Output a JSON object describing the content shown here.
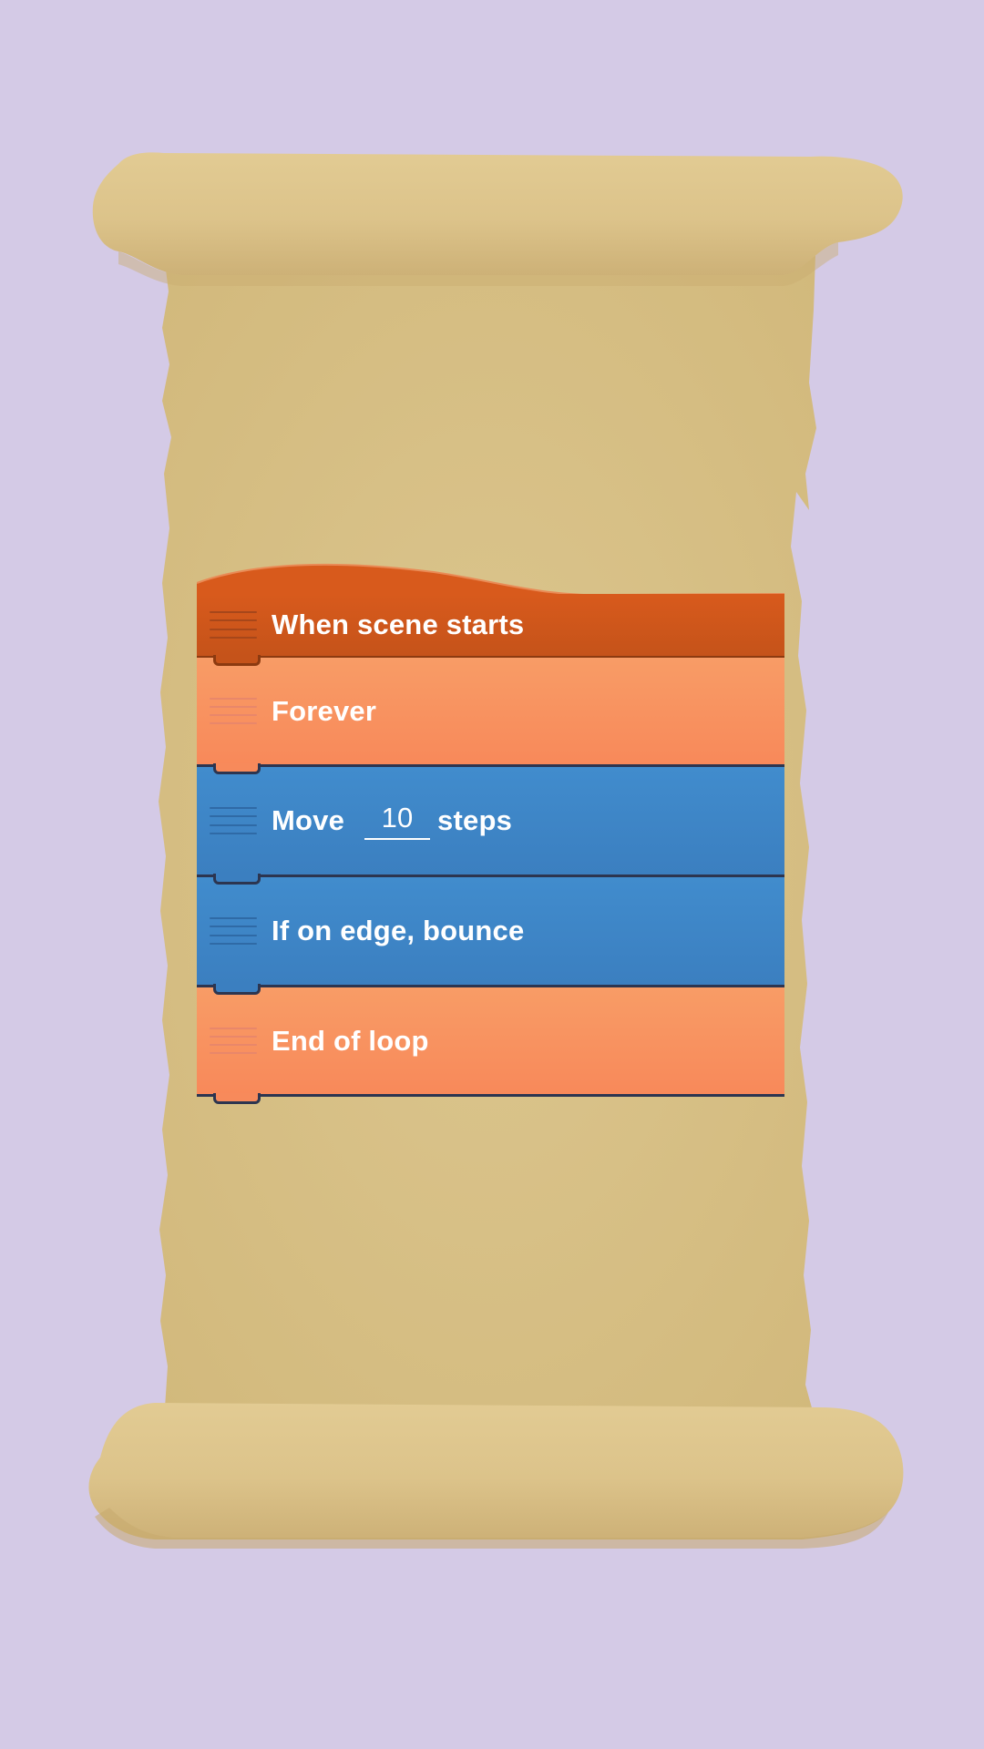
{
  "colors": {
    "background": "#d4cae6",
    "parchment": "#dcc58c",
    "event_block": "#c8541a",
    "control_block": "#f88f5e",
    "motion_block": "#3e86c7"
  },
  "script": {
    "blocks": [
      {
        "type": "event",
        "label": "When scene starts"
      },
      {
        "type": "control",
        "label": "Forever"
      },
      {
        "type": "motion",
        "label_before": "Move",
        "value": "10",
        "label_after": "steps"
      },
      {
        "type": "motion",
        "label": "If on edge, bounce"
      },
      {
        "type": "control",
        "label": "End of loop"
      }
    ]
  },
  "icons": {
    "grip": "drag-handle-icon",
    "scroll": "parchment-scroll-icon"
  }
}
